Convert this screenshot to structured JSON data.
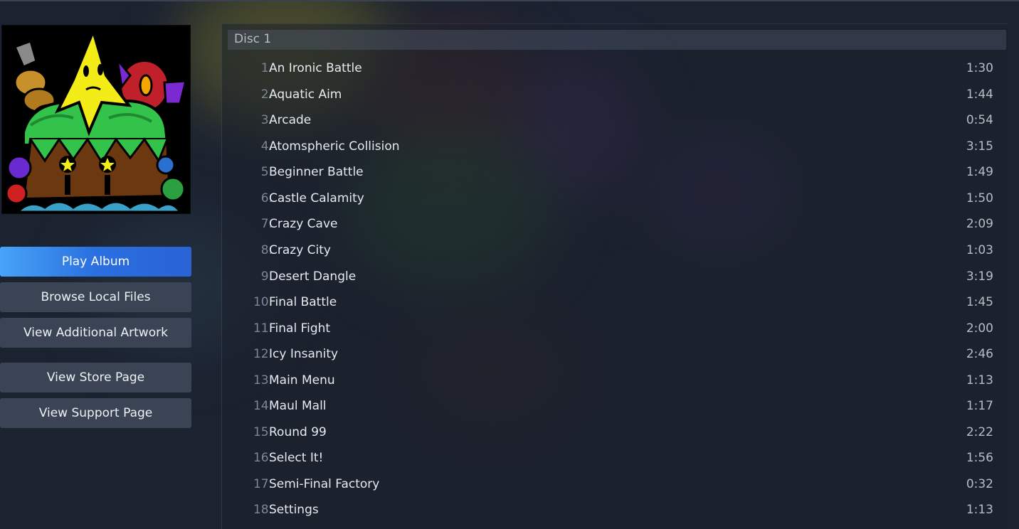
{
  "colors": {
    "background": "#1b2230",
    "button": "#3b4454",
    "primary_button": "#2a6fe0",
    "track_title": "#e7eaef",
    "track_number": "#7e8794",
    "duration": "#b7bdc6"
  },
  "album_art": {
    "icon": "album-cover-image"
  },
  "sidebar": {
    "buttons": [
      {
        "label": "Play Album"
      },
      {
        "label": "Browse Local Files"
      },
      {
        "label": "View Additional Artwork"
      },
      {
        "label": "View Store Page"
      },
      {
        "label": "View Support Page"
      }
    ]
  },
  "tracklist": {
    "disc_label": "Disc 1",
    "tracks": [
      {
        "number": "1.",
        "title": "An Ironic Battle",
        "duration": "1:30"
      },
      {
        "number": "2.",
        "title": "Aquatic Aim",
        "duration": "1:44"
      },
      {
        "number": "3.",
        "title": "Arcade",
        "duration": "0:54"
      },
      {
        "number": "4.",
        "title": "Atomspheric Collision",
        "duration": "3:15"
      },
      {
        "number": "5.",
        "title": "Beginner Battle",
        "duration": "1:49"
      },
      {
        "number": "6.",
        "title": "Castle Calamity",
        "duration": "1:50"
      },
      {
        "number": "7.",
        "title": "Crazy Cave",
        "duration": "2:09"
      },
      {
        "number": "8.",
        "title": "Crazy City",
        "duration": "1:03"
      },
      {
        "number": "9.",
        "title": "Desert Dangle",
        "duration": "3:19"
      },
      {
        "number": "10.",
        "title": "Final Battle",
        "duration": "1:45"
      },
      {
        "number": "11.",
        "title": "Final Fight",
        "duration": "2:00"
      },
      {
        "number": "12.",
        "title": "Icy Insanity",
        "duration": "2:46"
      },
      {
        "number": "13.",
        "title": "Main Menu",
        "duration": "1:13"
      },
      {
        "number": "14.",
        "title": "Maul Mall",
        "duration": "1:17"
      },
      {
        "number": "15.",
        "title": "Round 99",
        "duration": "2:22"
      },
      {
        "number": "16.",
        "title": "Select It!",
        "duration": "1:56"
      },
      {
        "number": "17.",
        "title": "Semi-Final Factory",
        "duration": "0:32"
      },
      {
        "number": "18.",
        "title": "Settings",
        "duration": "1:13"
      }
    ]
  }
}
